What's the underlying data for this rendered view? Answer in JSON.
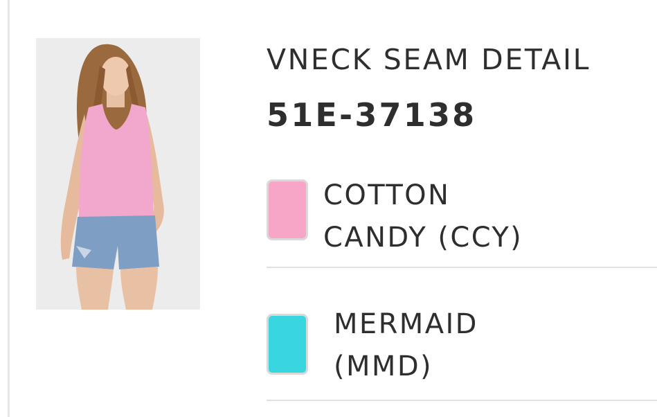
{
  "product": {
    "name": "VNECK SEAM DETAIL",
    "sku": "51E-37138",
    "image_icon": "product-photo-model-pink-tank"
  },
  "colors": [
    {
      "line1": "COTTON",
      "line2": "CANDY (CCY)",
      "swatch": "#f7a6c8"
    },
    {
      "line1": "MERMAID",
      "line2": "(MMD)",
      "swatch": "#3ad6df"
    }
  ],
  "theme": {
    "divider": "#e1e1e1",
    "text": "#2e2e2e",
    "image_bg": "#ececec"
  }
}
